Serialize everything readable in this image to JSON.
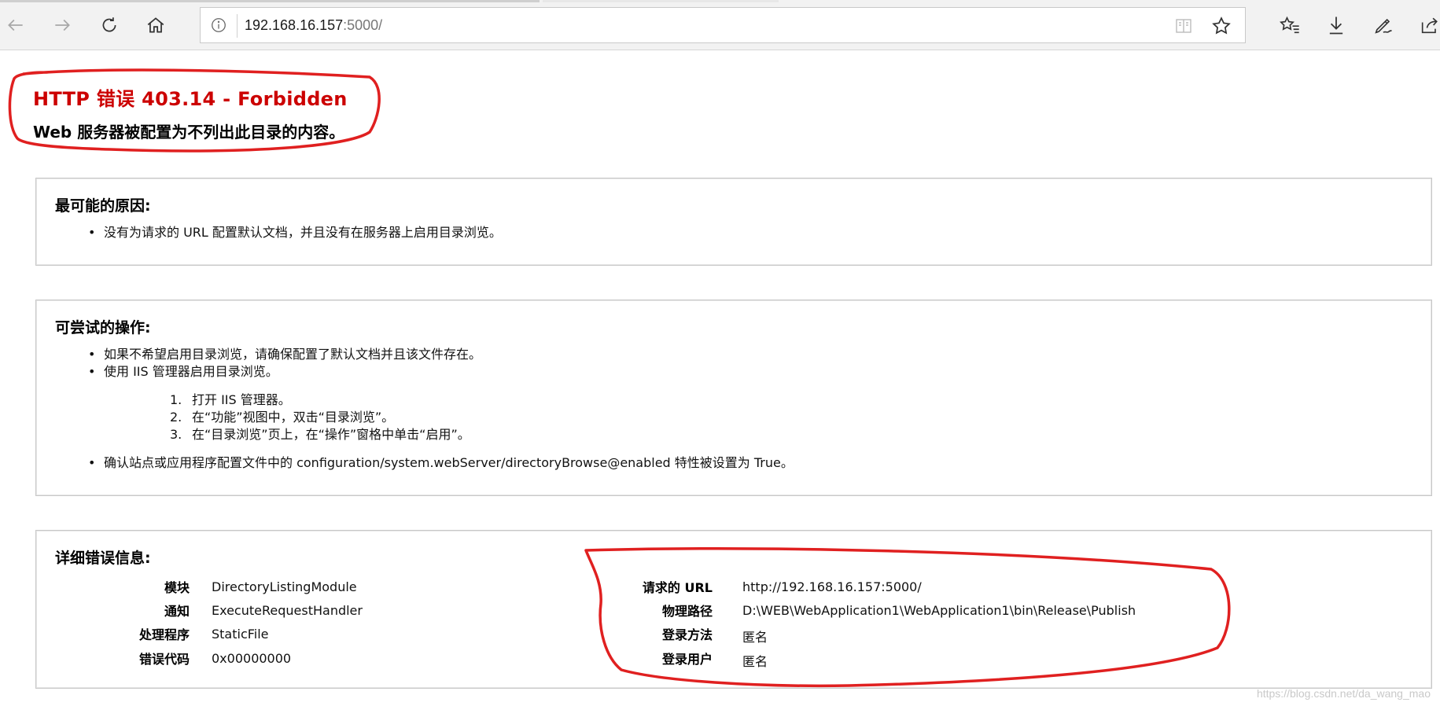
{
  "browser": {
    "address": {
      "host": "192.168.16.157",
      "port": ":5000/"
    }
  },
  "colors": {
    "error_red": "#cc0000",
    "annotation_red": "#e02020"
  },
  "error": {
    "title": "HTTP 错误 403.14 - Forbidden",
    "subtitle": "Web 服务器被配置为不列出此目录的内容。"
  },
  "causes": {
    "heading": "最可能的原因:",
    "items": [
      "没有为请求的 URL 配置默认文档，并且没有在服务器上启用目录浏览。"
    ]
  },
  "actions": {
    "heading": "可尝试的操作:",
    "items": [
      "如果不希望启用目录浏览，请确保配置了默认文档并且该文件存在。",
      "使用 IIS 管理器启用目录浏览。"
    ],
    "steps": [
      {
        "num": "1.",
        "text": "打开 IIS 管理器。"
      },
      {
        "num": "2.",
        "text": "在“功能”视图中，双击“目录浏览”。"
      },
      {
        "num": "3.",
        "text": "在“目录浏览”页上，在“操作”窗格中单击“启用”。"
      }
    ],
    "last_item": "确认站点或应用程序配置文件中的 configuration/system.webServer/directoryBrowse@enabled 特性被设置为 True。"
  },
  "details": {
    "heading": "详细错误信息:",
    "left": [
      {
        "key": "模块",
        "value": "DirectoryListingModule"
      },
      {
        "key": "通知",
        "value": "ExecuteRequestHandler"
      },
      {
        "key": "处理程序",
        "value": "StaticFile"
      },
      {
        "key": "错误代码",
        "value": "0x00000000"
      }
    ],
    "right": [
      {
        "key": "请求的 URL",
        "value": "http://192.168.16.157:5000/"
      },
      {
        "key": "物理路径",
        "value": "D:\\WEB\\WebApplication1\\WebApplication1\\bin\\Release\\Publish"
      },
      {
        "key": "登录方法",
        "value": "匿名"
      },
      {
        "key": "登录用户",
        "value": "匿名"
      }
    ]
  },
  "watermark": "https://blog.csdn.net/da_wang_mao"
}
